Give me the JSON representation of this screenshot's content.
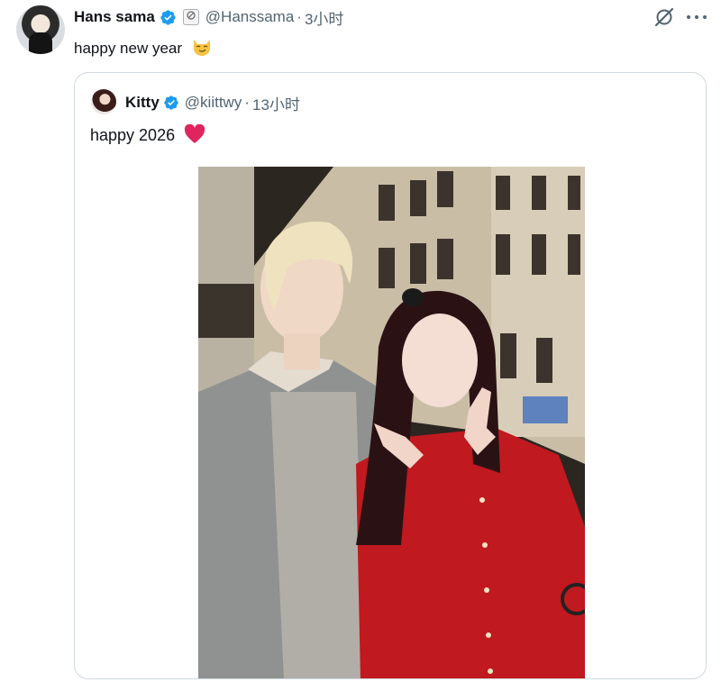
{
  "tweet": {
    "author_name": "Hans sama",
    "handle": "@Hanssama",
    "separator": "·",
    "time": "3小时",
    "text": "happy new year",
    "icons": {
      "verified": "verified-badge-icon",
      "org": "affiliate-badge-icon",
      "grok": "grok-icon",
      "more": "more-icon",
      "emoji": "smirk-cat-emoji"
    }
  },
  "quote": {
    "author_name": "Kitty",
    "handle": "@kiittwy",
    "separator": "·",
    "time": "13小时",
    "text": "happy 2026",
    "icons": {
      "verified": "verified-badge-icon",
      "emoji": "red-heart-icon"
    }
  },
  "colors": {
    "verified_blue": "#1d9bf0",
    "secondary_text": "#536471",
    "border": "#cfd9de",
    "heart_red": "#e0245e"
  }
}
